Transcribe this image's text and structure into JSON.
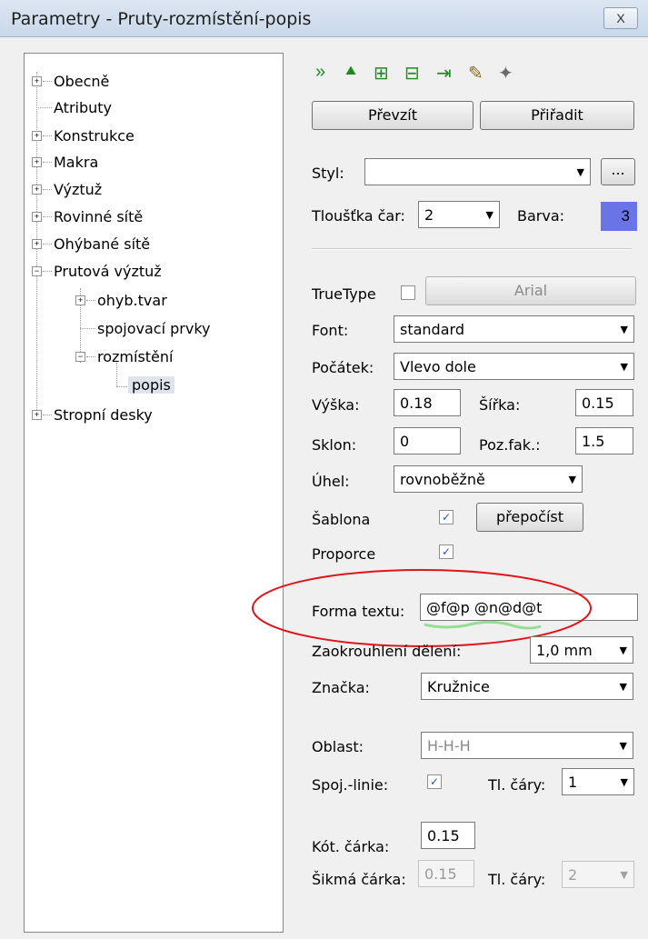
{
  "window": {
    "title": "Parametry - Pruty-rozmístění-popis",
    "close_label": "X"
  },
  "tree": {
    "items": [
      {
        "label": "Obecně",
        "expander": "+"
      },
      {
        "label": "Atributy",
        "expander": ""
      },
      {
        "label": "Konstrukce",
        "expander": "+"
      },
      {
        "label": "Makra",
        "expander": "+"
      },
      {
        "label": "Výztuž",
        "expander": "+"
      },
      {
        "label": "Rovinné sítě",
        "expander": "+"
      },
      {
        "label": "Ohýbané sítě",
        "expander": "+"
      },
      {
        "label": "Prutová výztuž",
        "expander": "−"
      },
      {
        "label": "ohyb.tvar",
        "expander": "+"
      },
      {
        "label": "spojovací prvky",
        "expander": ""
      },
      {
        "label": "rozmístění",
        "expander": "−"
      },
      {
        "label": "popis",
        "expander": "",
        "selected": true
      },
      {
        "label": "Stropní desky",
        "expander": "+"
      }
    ]
  },
  "toolbar": {
    "icons": [
      {
        "name": "forward-double-icon",
        "glyph": "»",
        "color": "#1f8a1f"
      },
      {
        "name": "up-arrow-icon",
        "glyph": "⯅",
        "color": "#1f8a1f"
      },
      {
        "name": "grid-add-icon",
        "glyph": "⊞",
        "color": "#1f8a1f"
      },
      {
        "name": "grid-remove-icon",
        "glyph": "⊟",
        "color": "#1f8a1f"
      },
      {
        "name": "pin-icon",
        "glyph": "⇥",
        "color": "#1f8a1f"
      },
      {
        "name": "brush-icon",
        "glyph": "✎",
        "color": "#8a6a1f"
      },
      {
        "name": "magic-wand-icon",
        "glyph": "✦",
        "color": "#6a6a6a"
      }
    ],
    "take_label": "Převzít",
    "assign_label": "Přiřadit"
  },
  "style": {
    "label": "Styl:",
    "value": "",
    "browse": "..."
  },
  "line": {
    "thickness_label": "Tloušťka čar:",
    "thickness_value": "2",
    "color_label": "Barva:",
    "color_value": "3",
    "color_hex": "#6a74e6"
  },
  "truetype": {
    "label": "TrueType",
    "checked": false,
    "font_button": "Arial"
  },
  "font": {
    "label": "Font:",
    "value": "standard"
  },
  "origin": {
    "label": "Počátek:",
    "value": "Vlevo dole"
  },
  "height": {
    "label": "Výška:",
    "value": "0.18"
  },
  "width": {
    "label": "Šířka:",
    "value": "0.15"
  },
  "slant": {
    "label": "Sklon:",
    "value": "0"
  },
  "posfac": {
    "label": "Poz.fak.:",
    "value": "1.5"
  },
  "angle": {
    "label": "Úhel:",
    "value": "rovnoběžně"
  },
  "template": {
    "label": "Šablona",
    "checked": true,
    "recalc_label": "přepočíst"
  },
  "proportion": {
    "label": "Proporce",
    "checked": true
  },
  "textform": {
    "label": "Forma textu:",
    "value": "@f@p @n@d@t"
  },
  "rounding": {
    "label": "Zaokrouhlení dělení:",
    "value": "1,0 mm"
  },
  "mark": {
    "label": "Značka:",
    "value": "Kružnice"
  },
  "area": {
    "label": "Oblast:",
    "value": "H-H-H"
  },
  "connline": {
    "label": "Spoj.-linie:",
    "checked": true,
    "thickness_label": "Tl. čáry:",
    "thickness_value": "1"
  },
  "dim_tick": {
    "label": "Kót. čárka:",
    "value": "0.15"
  },
  "oblique_tick": {
    "label": "Šikmá čárka:",
    "value": "0.15",
    "thickness_label": "Tl. čáry:",
    "thickness_value": "2"
  },
  "colors": {
    "annotation": "#e0141b",
    "highlight": "#6a74e6"
  }
}
